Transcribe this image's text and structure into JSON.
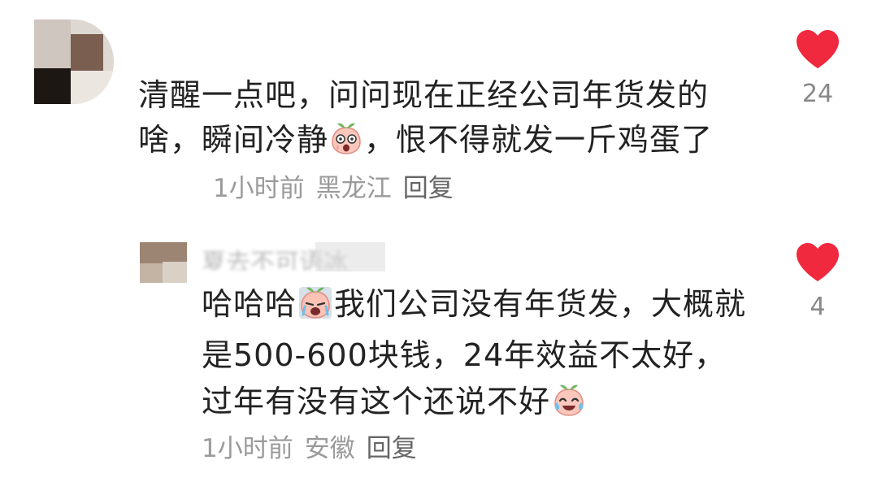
{
  "comment": {
    "text_before_emoji": "清醒一点吧，问问现在正经公司年货发的啥，瞬间冷静",
    "emoji": "emoji-peach-shocked",
    "text_after_emoji": "，恨不得就发一斤鸡蛋了",
    "time": "1小时前",
    "location": "黑龙江",
    "reply_label": "回复",
    "likes": "24"
  },
  "reply": {
    "username": "夏去不可语冰",
    "text_part1": "哈哈哈",
    "emoji1": "emoji-peach-crying",
    "text_part2": "我们公司没有年货发，大概就是500-600块钱，24年效益不太好，过年有没有这个还说不好",
    "emoji2": "emoji-peach-laugh-cry",
    "time": "1小时前",
    "location": "安徽",
    "reply_label": "回复",
    "likes": "4"
  },
  "colors": {
    "heart": "#f0293e",
    "meta_text": "#9a9a9a",
    "body_text": "#222222"
  }
}
